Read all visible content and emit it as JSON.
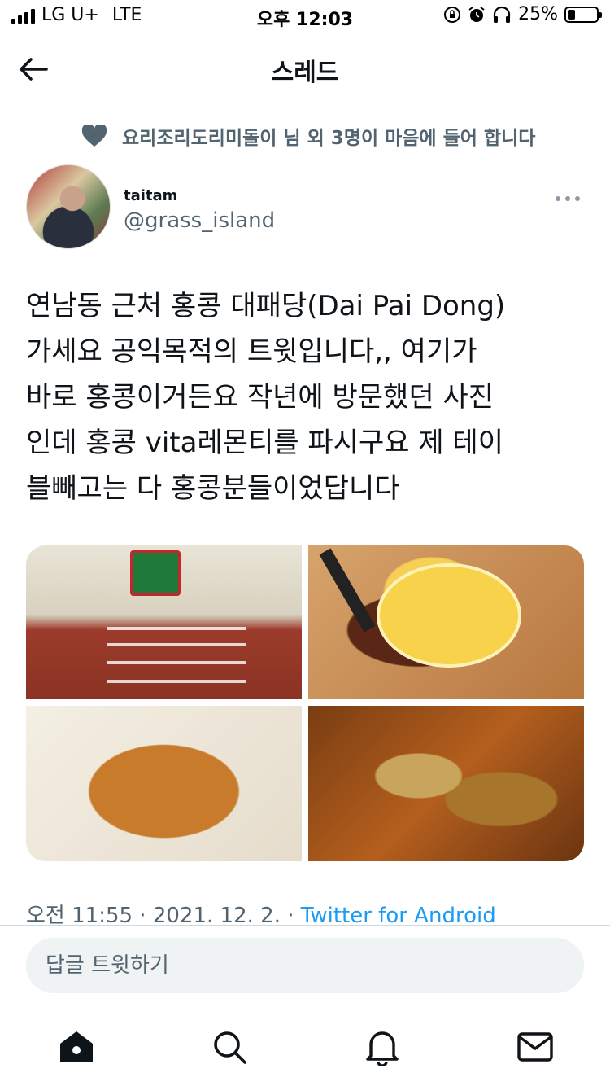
{
  "status_bar": {
    "carrier": "LG U+",
    "network": "LTE",
    "time": "오후 12:03",
    "battery_percent": "25%",
    "battery_level": 0.25
  },
  "header": {
    "title": "스레드"
  },
  "social_context": {
    "text": "요리조리도리미돌이 님 외 3명이 마음에 들어 합니다"
  },
  "tweet": {
    "author_name": "taitam",
    "author_handle": "@grass_island",
    "text": "연남동 근처 홍콩 대패당(Dai Pai Dong)\n가세요 공익목적의 트윗입니다,, 여기가\n바로 홍콩이거든요 작년에 방문했던 사진\n인데 홍콩 vita레몬티를 파시구요 제 테이\n블빼고는 다 홍콩분들이었답니다",
    "time": "오전 11:55",
    "separator": " · ",
    "date": "2021. 12. 2.",
    "source": "Twitter for Android",
    "media": [
      "stairs-photo",
      "lemon-tea-photo",
      "fried-squid-photo",
      "clams-photo"
    ]
  },
  "reply": {
    "placeholder": "답글 트윗하기"
  },
  "tabbar": {
    "items": [
      "home-icon",
      "search-icon",
      "bell-icon",
      "mail-icon"
    ]
  },
  "colors": {
    "accent": "#1d9bf0",
    "secondary_text": "#536471",
    "primary_text": "#0f1419"
  }
}
